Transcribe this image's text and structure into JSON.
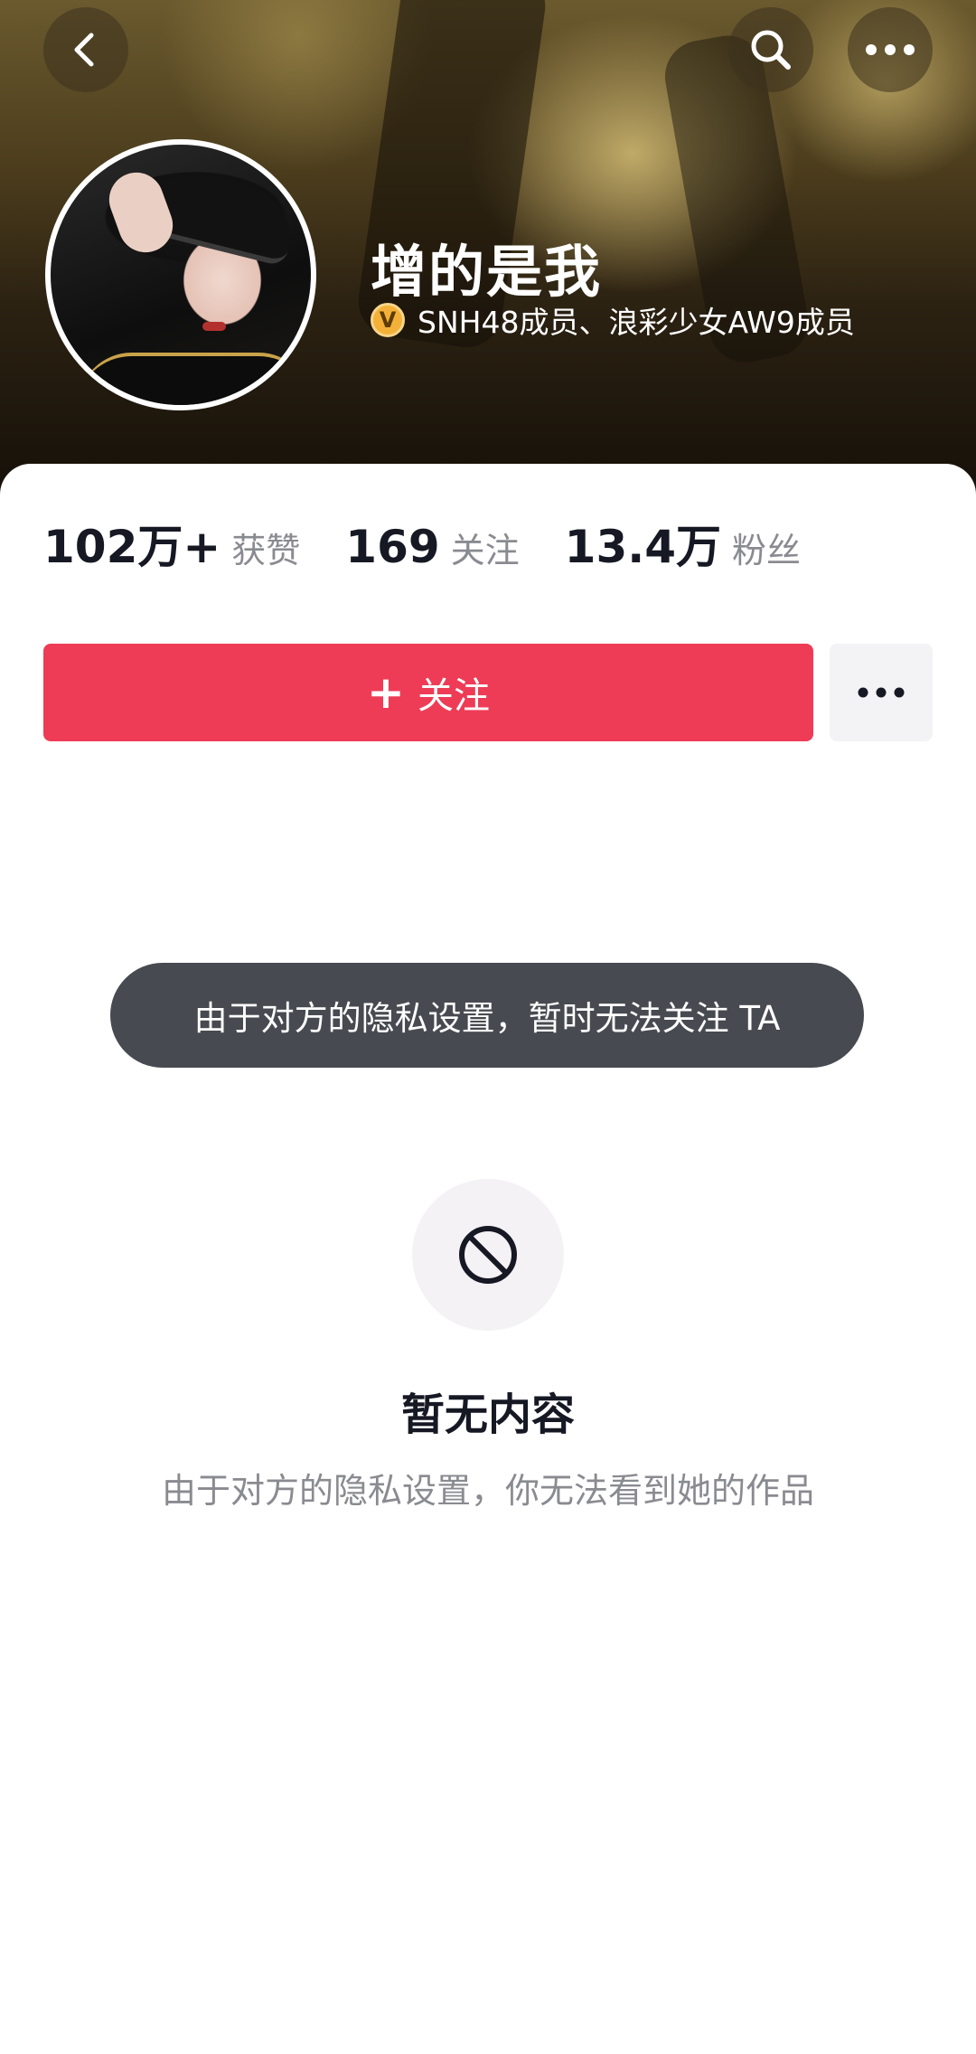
{
  "profile": {
    "name": "增的是我",
    "verify_badge": "V",
    "verify_text": "SNH48成员、浪彩少女AW9成员"
  },
  "stats": [
    {
      "value": "102万+",
      "label": "获赞"
    },
    {
      "value": "169",
      "label": "关注"
    },
    {
      "value": "13.4万",
      "label": "粉丝"
    }
  ],
  "actions": {
    "follow_plus": "+",
    "follow_label": "关注"
  },
  "toast": {
    "text": "由于对方的隐私设置，暂时无法关注 TA"
  },
  "empty": {
    "title": "暂无内容",
    "subtitle": "由于对方的隐私设置，你无法看到她的作品"
  },
  "icons": {
    "back": "chevron-left-icon",
    "search": "search-icon",
    "more": "more-horizontal-icon",
    "verified": "verified-badge-icon",
    "prohibited": "prohibited-icon"
  },
  "colors": {
    "follow_button": "#ee3c56",
    "verify_badge": "#f4b13a",
    "toast_bg": "#474a50",
    "muted_text": "#8a8b91"
  }
}
